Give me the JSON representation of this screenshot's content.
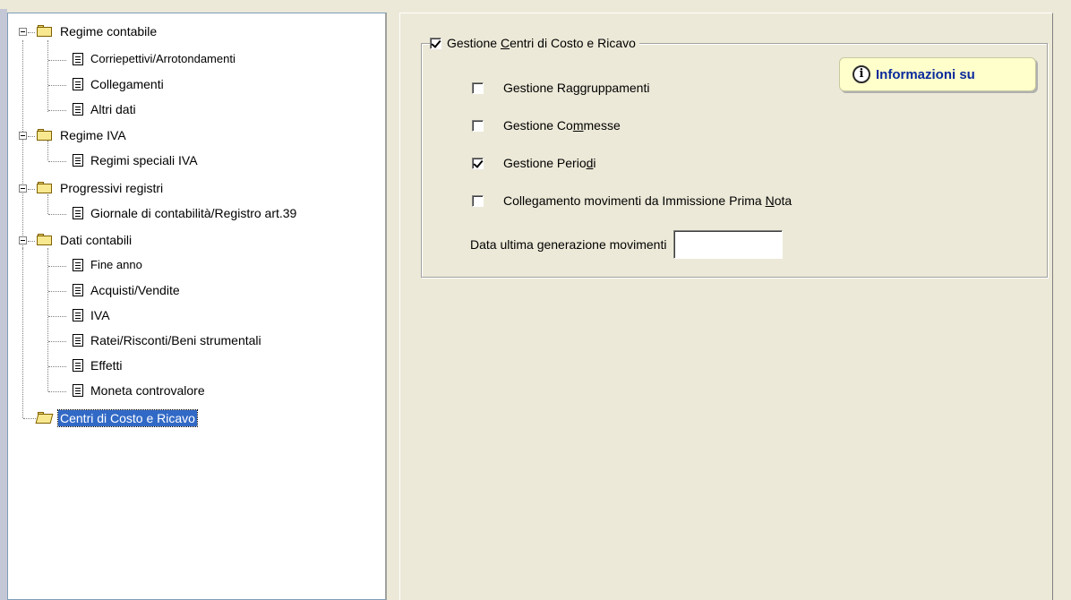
{
  "tree": {
    "nodes": [
      {
        "label": "Regime contabile",
        "kind": "folder"
      },
      {
        "label": "Corriepettivi/Arrotondamenti",
        "kind": "doc"
      },
      {
        "label": "Collegamenti",
        "kind": "doc"
      },
      {
        "label": "Altri dati",
        "kind": "doc"
      },
      {
        "label": "Regime IVA",
        "kind": "folder"
      },
      {
        "label": "Regimi speciali IVA",
        "kind": "doc"
      },
      {
        "label": "Progressivi registri",
        "kind": "folder"
      },
      {
        "label": "Giornale di contabilità/Registro art.39",
        "kind": "doc"
      },
      {
        "label": "Dati contabili",
        "kind": "folder"
      },
      {
        "label": "Fine anno",
        "kind": "doc"
      },
      {
        "label": "Acquisti/Vendite",
        "kind": "doc"
      },
      {
        "label": "IVA",
        "kind": "doc"
      },
      {
        "label": "Ratei/Risconti/Beni strumentali",
        "kind": "doc"
      },
      {
        "label": "Effetti",
        "kind": "doc"
      },
      {
        "label": "Moneta controvalore",
        "kind": "doc"
      },
      {
        "label": "Centri di Costo e Ricavo",
        "kind": "folder-open",
        "selected": true
      }
    ]
  },
  "form": {
    "group_title_pre": "Gestione ",
    "group_title_ul": "C",
    "group_title_post": "entri di Costo e Ricavo",
    "group_checked": true,
    "info_button_label": "Informazioni su",
    "options": [
      {
        "pre": "Gestione Ra",
        "ul": "g",
        "post": "gruppamenti",
        "checked": false
      },
      {
        "pre": "Gestione Co",
        "ul": "m",
        "post": "messe",
        "checked": false
      },
      {
        "pre": "Gestione Perio",
        "ul": "d",
        "post": "i",
        "checked": true
      },
      {
        "pre": "Collegamento movimenti da Immissione Prima ",
        "ul": "N",
        "post": "ota",
        "checked": false
      }
    ],
    "date_label": "Data ultima generazione movimenti",
    "date_value": ""
  },
  "colors": {
    "selection": "#3169c6",
    "info_text": "#0a2a9c",
    "info_bg": "#ffffcc",
    "window_bg": "#ece9d8"
  }
}
